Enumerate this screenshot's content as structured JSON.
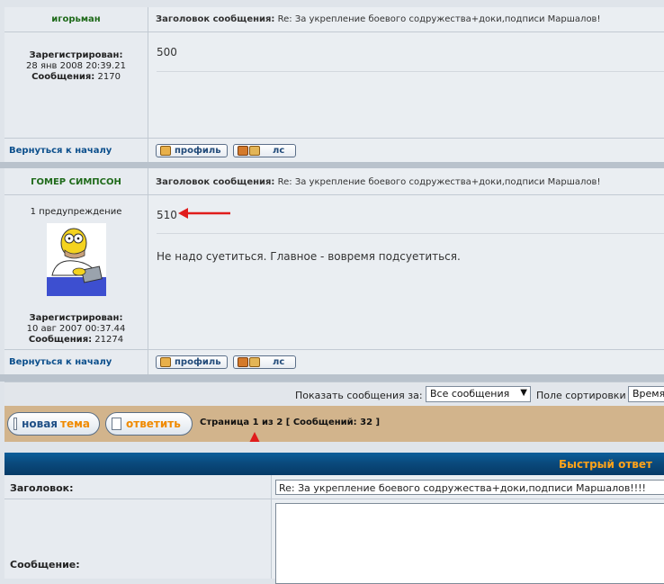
{
  "posts": [
    {
      "username": "игорьман",
      "subject_label": "Заголовок сообщения:",
      "subject": "Re: За укрепление боевого содружества+доки,подписи Маршалов!",
      "body_line1": "500",
      "body_line2": "",
      "warning": "",
      "registered_label": "Зарегистрирован:",
      "registered_date": "28 янв 2008 20:39.21",
      "messages_label": "Сообщения:",
      "messages_count": "2170",
      "back_link": "Вернуться к началу",
      "profile_btn": "профиль",
      "pm_btn": "лс"
    },
    {
      "username": "ГОМЕР СИМПСОН",
      "subject_label": "Заголовок сообщения:",
      "subject": "Re: За укрепление боевого содружества+доки,подписи Маршалов!",
      "body_line1": "510",
      "body_line2": "Не надо суетиться. Главное - вовремя подсуетиться.",
      "warning": "1 предупреждение",
      "registered_label": "Зарегистрирован:",
      "registered_date": "10 авг 2007 00:37.44",
      "messages_label": "Сообщения:",
      "messages_count": "21274",
      "back_link": "Вернуться к началу",
      "profile_btn": "профиль",
      "pm_btn": "лс"
    }
  ],
  "filter_bar": {
    "show_label": "Показать сообщения за:",
    "show_value": "Все сообщения",
    "sort_label": "Поле сортировки",
    "sort_value": "Время"
  },
  "action_bar": {
    "new_topic_prefix": "новая",
    "new_topic_suffix": "тема",
    "reply_btn": "ответить",
    "page_info": "Страница 1 из 2 [ Сообщений: 32 ]"
  },
  "quick_reply": {
    "title": "Быстрый ответ",
    "subject_label": "Заголовок:",
    "subject_value": "Re: За укрепление боевого содружества+доки,подписи Маршалов!!!!",
    "message_label": "Сообщение:"
  },
  "colors": {
    "annotation_arrow": "#e01c1c",
    "tan_bar": "#d2b48c",
    "quick_reply_title": "#ffa31a",
    "username_green": "#1f6a1a"
  },
  "icons": [
    "profile-icon",
    "pm-icon",
    "document-icon",
    "dropdown-arrow-icon",
    "red-arrow-annotation"
  ]
}
